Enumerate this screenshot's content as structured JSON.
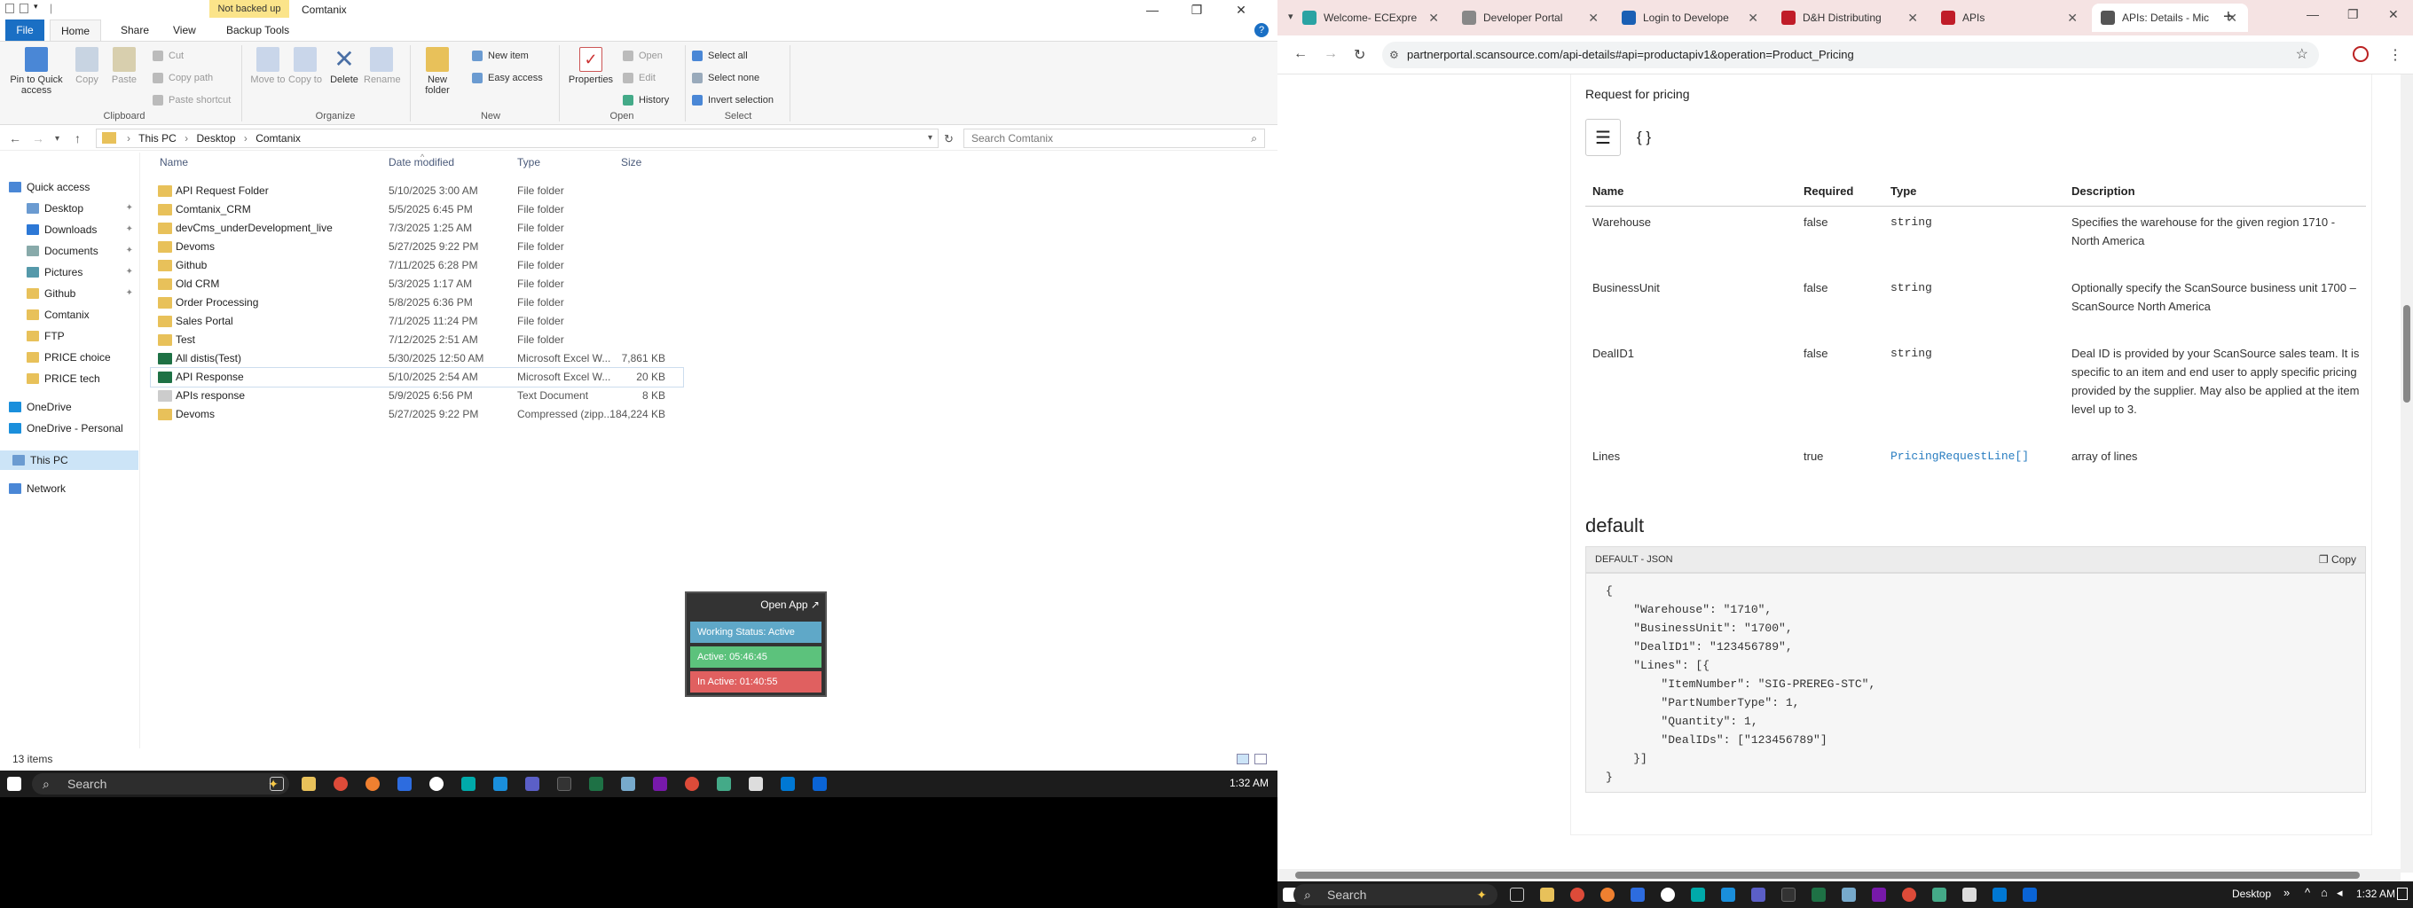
{
  "explorer": {
    "window_title": "Comtanix",
    "warning": "Not backed up",
    "tabs": [
      "File",
      "Home",
      "Share",
      "View",
      "Backup Tools"
    ],
    "ribbon": {
      "pin": "Pin to Quick access",
      "copy": "Copy",
      "paste": "Paste",
      "cut": "Cut",
      "copy_path": "Copy path",
      "paste_shortcut": "Paste shortcut",
      "move_to": "Move to",
      "copy_to": "Copy to",
      "delete": "Delete",
      "rename": "Rename",
      "new_folder": "New folder",
      "new_item": "New item",
      "easy_access": "Easy access",
      "properties": "Properties",
      "open": "Open",
      "edit": "Edit",
      "history": "History",
      "select_all": "Select all",
      "select_none": "Select none",
      "invert_selection": "Invert selection",
      "groups": [
        "Clipboard",
        "Organize",
        "New",
        "Open",
        "Select"
      ]
    },
    "breadcrumb": [
      "This PC",
      "Desktop",
      "Comtanix"
    ],
    "search_placeholder": "Search Comtanix",
    "columns": [
      "Name",
      "Date modified",
      "Type",
      "Size"
    ],
    "nav": [
      {
        "label": "Quick access",
        "pin": false
      },
      {
        "label": "Desktop",
        "pin": true
      },
      {
        "label": "Downloads",
        "pin": true
      },
      {
        "label": "Documents",
        "pin": true
      },
      {
        "label": "Pictures",
        "pin": true
      },
      {
        "label": "Github",
        "pin": true
      },
      {
        "label": "Comtanix",
        "pin": false
      },
      {
        "label": "FTP",
        "pin": false
      },
      {
        "label": "PRICE choice",
        "pin": false
      },
      {
        "label": "PRICE tech",
        "pin": false
      },
      {
        "label": "OneDrive",
        "pin": false
      },
      {
        "label": "OneDrive - Personal",
        "pin": false
      },
      {
        "label": "This PC",
        "pin": false
      },
      {
        "label": "Network",
        "pin": false
      }
    ],
    "files": [
      {
        "name": "API Request Folder",
        "date": "5/10/2025 3:00 AM",
        "type": "File folder",
        "size": "",
        "kind": "folder"
      },
      {
        "name": "Comtanix_CRM",
        "date": "5/5/2025 6:45 PM",
        "type": "File folder",
        "size": "",
        "kind": "folder"
      },
      {
        "name": "devCms_underDevelopment_live",
        "date": "7/3/2025 1:25 AM",
        "type": "File folder",
        "size": "",
        "kind": "folder"
      },
      {
        "name": "Devoms",
        "date": "5/27/2025 9:22 PM",
        "type": "File folder",
        "size": "",
        "kind": "folder"
      },
      {
        "name": "Github",
        "date": "7/11/2025 6:28 PM",
        "type": "File folder",
        "size": "",
        "kind": "folder"
      },
      {
        "name": "Old CRM",
        "date": "5/3/2025 1:17 AM",
        "type": "File folder",
        "size": "",
        "kind": "folder"
      },
      {
        "name": "Order Processing",
        "date": "5/8/2025 6:36 PM",
        "type": "File folder",
        "size": "",
        "kind": "folder"
      },
      {
        "name": "Sales Portal",
        "date": "7/1/2025 11:24 PM",
        "type": "File folder",
        "size": "",
        "kind": "folder"
      },
      {
        "name": "Test",
        "date": "7/12/2025 2:51 AM",
        "type": "File folder",
        "size": "",
        "kind": "folder"
      },
      {
        "name": "All distis(Test)",
        "date": "5/30/2025 12:50 AM",
        "type": "Microsoft Excel W...",
        "size": "7,861 KB",
        "kind": "excel"
      },
      {
        "name": "API Response",
        "date": "5/10/2025 2:54 AM",
        "type": "Microsoft Excel W...",
        "size": "20 KB",
        "kind": "excel"
      },
      {
        "name": "APIs response",
        "date": "5/9/2025 6:56 PM",
        "type": "Text Document",
        "size": "8 KB",
        "kind": "text"
      },
      {
        "name": "Devoms",
        "date": "5/27/2025 9:22 PM",
        "type": "Compressed (zipp...",
        "size": "184,224 KB",
        "kind": "zip"
      }
    ],
    "status": "13 items"
  },
  "widget": {
    "open_app": "Open App ↗",
    "working": "Working Status: Active",
    "active": "Active: 05:46:45",
    "inactive": "In Active: 01:40:55"
  },
  "taskbar_left": {
    "search": "Search",
    "clock": "1:32 AM"
  },
  "browser": {
    "tabs": [
      {
        "label": "Welcome- ECExpre",
        "color": "#2aa3a3"
      },
      {
        "label": "Developer Portal",
        "color": "#888888"
      },
      {
        "label": "Login to Develope",
        "color": "#1a5fb4"
      },
      {
        "label": "D&H Distributing",
        "color": "#c01c28"
      },
      {
        "label": "APIs",
        "color": "#c01c28"
      },
      {
        "label": "APIs: Details - Mic",
        "color": "#555555"
      }
    ],
    "url": "partnerportal.scansource.com/api-details#api=productapiv1&operation=Product_Pricing",
    "request_title": "Request for pricing",
    "table_headers": [
      "Name",
      "Required",
      "Type",
      "Description"
    ],
    "rows": [
      {
        "name": "Warehouse",
        "required": "false",
        "type": "string",
        "desc": "Specifies the warehouse for the given region 1710 - North America"
      },
      {
        "name": "BusinessUnit",
        "required": "false",
        "type": "string",
        "desc": "Optionally specify the ScanSource business unit 1700 – ScanSource North America"
      },
      {
        "name": "DealID1",
        "required": "false",
        "type": "string",
        "desc": "Deal ID is provided by your ScanSource sales team. It is specific to an item and end user to apply specific pricing provided by the supplier. May also be applied at the item level up to 3."
      },
      {
        "name": "Lines",
        "required": "true",
        "type": "PricingRequestLine[]",
        "desc": "array of lines"
      }
    ],
    "section": "default",
    "code_title": "DEFAULT - JSON",
    "copy": "Copy",
    "code_lines": [
      "{",
      "    \"Warehouse\": \"1710\",",
      "    \"BusinessUnit\": \"1700\",",
      "    \"DealID1\": \"123456789\",",
      "    \"Lines\": [{",
      "        \"ItemNumber\": \"SIG-PREREG-STC\",",
      "        \"PartNumberType\": 1,",
      "        \"Quantity\": 1,",
      "        \"DealIDs\": [\"123456789\"]",
      "    }]",
      "}"
    ]
  },
  "taskbar_right": {
    "search": "Search",
    "desktop": "Desktop",
    "clock": "1:32 AM"
  }
}
